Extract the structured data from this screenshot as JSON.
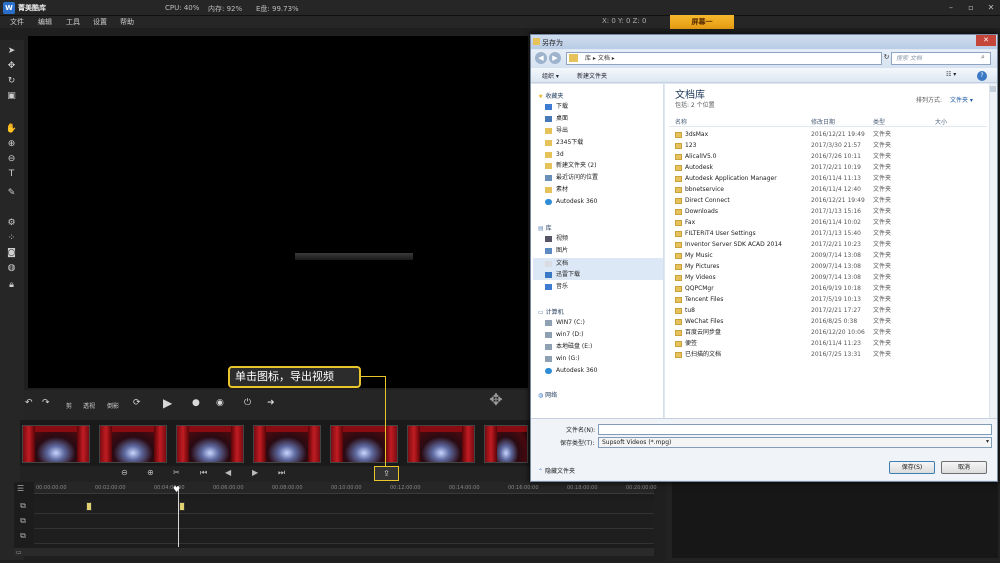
{
  "app": {
    "name": "菁美酷库",
    "stats": {
      "cpu": "CPU: 40%",
      "mem": "内存: 92%",
      "disk": "E盘: 99.73%"
    },
    "coords": "X: 0 Y: 0 Z: 0",
    "screen_button": "屏幕一"
  },
  "menu": [
    "文件",
    "编辑",
    "工具",
    "设置",
    "帮助"
  ],
  "transport": {
    "labels": [
      "剪",
      "透视",
      "倒影"
    ]
  },
  "tooltip": "单击图标，导出视频",
  "timeline": {
    "ticks": [
      "00:00:00:00",
      "00:02:00:00",
      "00:04:00:00",
      "00:06:00:00",
      "00:08:00:00",
      "00:10:00:00",
      "00:12:00:00",
      "00:14:00:00",
      "00:16:00:00",
      "00:18:00:00",
      "00:20:00:00"
    ]
  },
  "dialog": {
    "title": "另存为",
    "address": "库 ▸ 文档 ▸",
    "search_placeholder": "搜索 文档",
    "toolbar": {
      "organize": "组织 ▾",
      "new_folder": "新建文件夹"
    },
    "nav": {
      "favorites_title": "收藏夹",
      "favorites": [
        "下载",
        "桌面",
        "导出",
        "2345下载",
        "3d",
        "新建文件夹 (2)",
        "最近访问的位置",
        "素材",
        "Autodesk 360"
      ],
      "libraries_title": "库",
      "libraries": [
        "视频",
        "图片",
        "文档",
        "迅雷下载",
        "音乐"
      ],
      "computer_title": "计算机",
      "computer": [
        "WIN7 (C:)",
        "win7 (D:)",
        "本地磁盘 (E:)",
        "win (G:)",
        "Autodesk 360"
      ],
      "network_title": "网络"
    },
    "library_title": "文档库",
    "library_sub": "包括: 2 个位置",
    "sort_label": "排列方式:",
    "sort_value": "文件夹 ▾",
    "columns": [
      "名称",
      "修改日期",
      "类型",
      "大小"
    ],
    "files": [
      {
        "name": "3dsMax",
        "date": "2016/12/21 19:49",
        "type": "文件夹"
      },
      {
        "name": "123",
        "date": "2017/3/30 21:57",
        "type": "文件夹"
      },
      {
        "name": "AlicalIV5.0",
        "date": "2016/7/26 10:11",
        "type": "文件夹"
      },
      {
        "name": "Autodesk",
        "date": "2017/2/21 10:19",
        "type": "文件夹"
      },
      {
        "name": "Autodesk Application Manager",
        "date": "2016/11/4 11:13",
        "type": "文件夹"
      },
      {
        "name": "bbnetservice",
        "date": "2016/11/4 12:40",
        "type": "文件夹"
      },
      {
        "name": "Direct Connect",
        "date": "2016/12/21 19:49",
        "type": "文件夹"
      },
      {
        "name": "Downloads",
        "date": "2017/1/13 15:16",
        "type": "文件夹"
      },
      {
        "name": "Fax",
        "date": "2016/11/4 10:02",
        "type": "文件夹"
      },
      {
        "name": "FILTERiT4 User Settings",
        "date": "2017/1/13 15:40",
        "type": "文件夹"
      },
      {
        "name": "Inventor Server SDK ACAD 2014",
        "date": "2017/2/21 10:23",
        "type": "文件夹"
      },
      {
        "name": "My Music",
        "date": "2009/7/14 13:08",
        "type": "文件夹"
      },
      {
        "name": "My Pictures",
        "date": "2009/7/14 13:08",
        "type": "文件夹"
      },
      {
        "name": "My Videos",
        "date": "2009/7/14 13:08",
        "type": "文件夹"
      },
      {
        "name": "QQPCMgr",
        "date": "2016/9/19 10:18",
        "type": "文件夹"
      },
      {
        "name": "Tencent Files",
        "date": "2017/5/19 10:13",
        "type": "文件夹"
      },
      {
        "name": "tu8",
        "date": "2017/2/21 17:27",
        "type": "文件夹"
      },
      {
        "name": "WeChat Files",
        "date": "2016/8/25 0:38",
        "type": "文件夹"
      },
      {
        "name": "百度云同步盘",
        "date": "2016/12/20 10:06",
        "type": "文件夹"
      },
      {
        "name": "便签",
        "date": "2016/11/4 11:23",
        "type": "文件夹"
      },
      {
        "name": "已扫描的文档",
        "date": "2016/7/25 13:31",
        "type": "文件夹"
      }
    ],
    "filename_label": "文件名(N):",
    "filename_value": "",
    "filetype_label": "保存类型(T):",
    "filetype_value": "Supsoft Videos (*.mpg)",
    "hide_folders": "隐藏文件夹",
    "save_button": "保存(S)",
    "cancel_button": "取消"
  }
}
